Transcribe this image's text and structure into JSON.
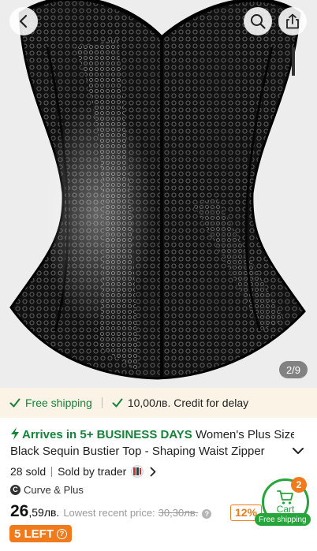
{
  "colors": {
    "accent_green": "#17813a",
    "cart_green": "#25a53a",
    "orange": "#f07b1d",
    "banner_bg": "#fbf3e6"
  },
  "gallery": {
    "image_counter": "2/9",
    "icons": {
      "back": "chevron-left-icon",
      "search": "search-icon",
      "share": "share-icon"
    }
  },
  "shipping_bar": {
    "free_shipping": "Free shipping",
    "credit": "10,00лв. Credit for delay"
  },
  "product": {
    "arrives": "Arrives in 5+ BUSINESS DAYS",
    "title_part1": "Women's Plus Size",
    "title_part2": "Black Sequin Bustier Top - Shaping Waist Zipper",
    "sold_count": "28 sold",
    "sold_by": "Sold by trader",
    "brand": "Curve & Plus",
    "brand_initial": "C",
    "price_int": "26",
    "price_dec": ",59лв.",
    "lowest_label": "Lowest recent price:",
    "old_price": "30,30лв.",
    "discount": "12%",
    "stock_badge": "5 LEFT"
  },
  "cart": {
    "label": "Cart",
    "count": "2",
    "free_shipping": "Free shipping"
  }
}
